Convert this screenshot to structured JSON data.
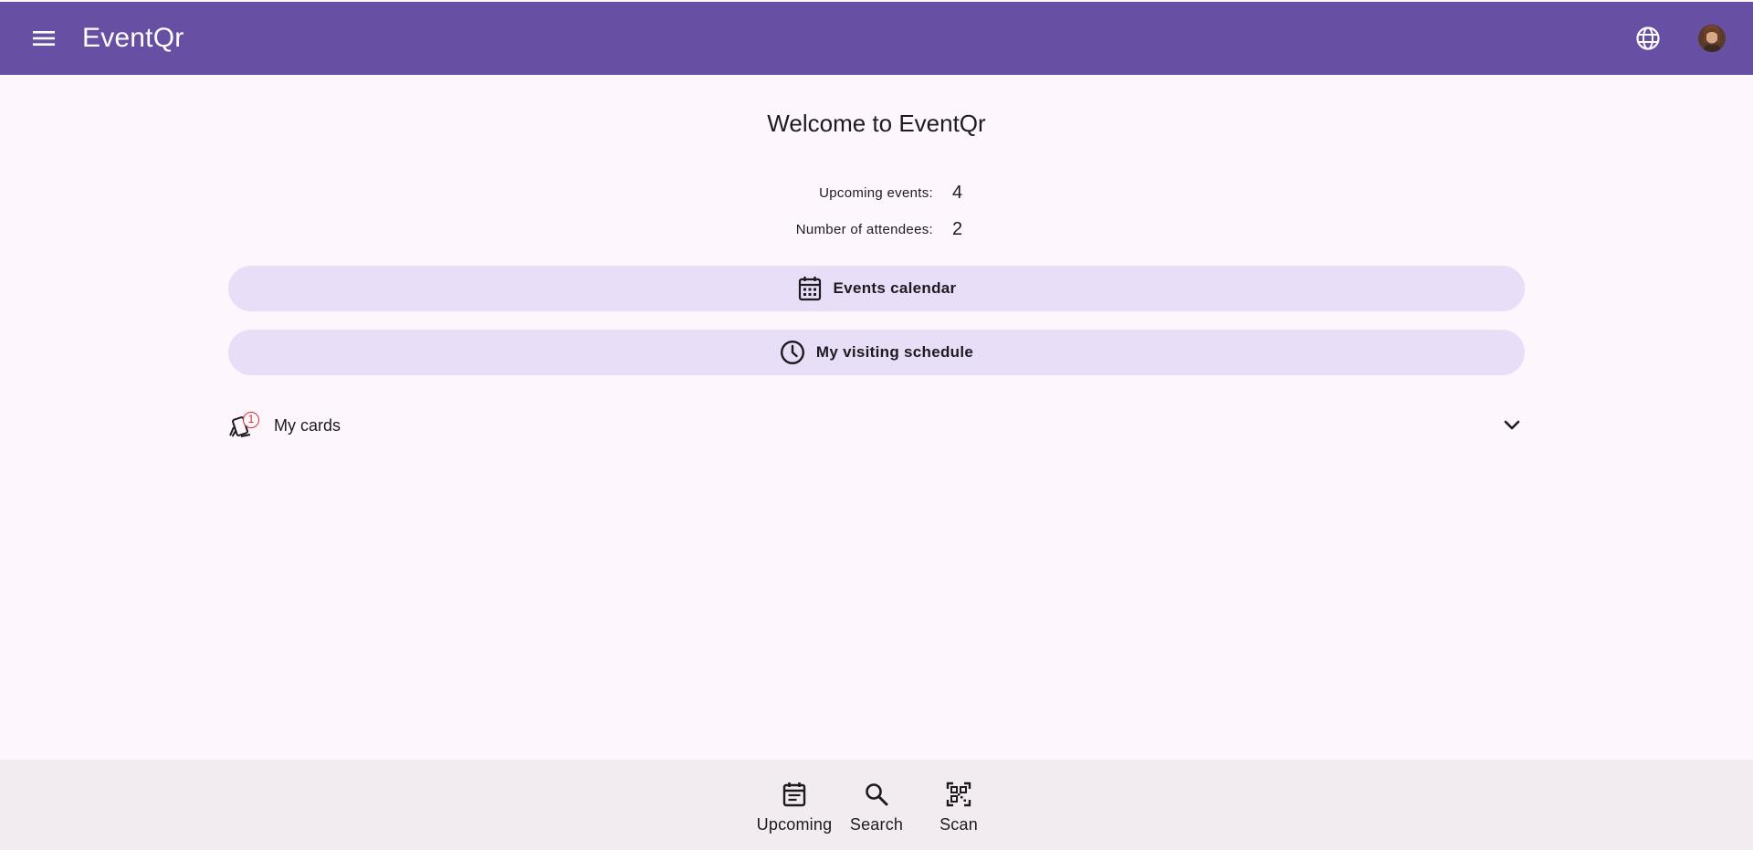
{
  "header": {
    "app_title": "EventQr",
    "menu_icon": "menu-icon",
    "language_icon": "globe-icon",
    "avatar_icon": "user-avatar",
    "background_color": "#6750a4"
  },
  "main": {
    "welcome_title": "Welcome to EventQr",
    "stats": [
      {
        "label": "Upcoming events:",
        "value": "4"
      },
      {
        "label": "Number of attendees:",
        "value": "2"
      }
    ],
    "actions": [
      {
        "label": "Events calendar",
        "icon": "calendar-icon"
      },
      {
        "label": "My visiting schedule",
        "icon": "clock-icon"
      }
    ],
    "cards": {
      "label": "My cards",
      "badge": "1",
      "icon": "cards-icon",
      "expand_icon": "chevron-down-icon"
    },
    "pill_color": "#e8def8"
  },
  "bottom_nav": {
    "items": [
      {
        "label": "Upcoming",
        "icon": "event-note-icon"
      },
      {
        "label": "Search",
        "icon": "search-icon"
      },
      {
        "label": "Scan",
        "icon": "qr-scan-icon"
      }
    ]
  }
}
